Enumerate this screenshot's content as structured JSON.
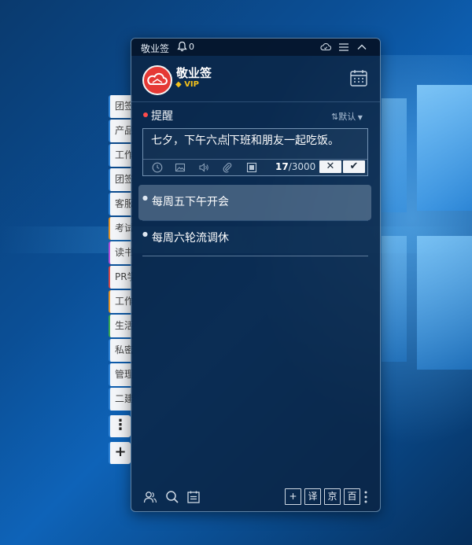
{
  "side_tabs": [
    "团签",
    "产品",
    "工作",
    "团签",
    "客服",
    "考试",
    "读书",
    "PR学",
    "工作",
    "生活",
    "私密",
    "管理",
    "二建"
  ],
  "side_buttons": {
    "more": "⋮",
    "add": "+"
  },
  "titlebar": {
    "app_name": "敬业签",
    "notification_count": "0"
  },
  "profile": {
    "name": "敬业签",
    "vip_badge": "VIP"
  },
  "section": {
    "title": "提醒",
    "sort_label": "默认"
  },
  "editor": {
    "text_before_caret": "七夕，下午六点",
    "text_after_caret": "下班和朋友一起吃饭。",
    "char_count": "17",
    "char_limit": "/3000"
  },
  "items": [
    {
      "text": "每周五下午开会",
      "selected": true
    },
    {
      "text": "每周六轮流调休",
      "selected": false
    }
  ],
  "footer": {
    "buttons": [
      "+",
      "译",
      "京",
      "百"
    ]
  },
  "colors": {
    "accent_red": "#e53935",
    "vip_gold": "#f4c21b",
    "window_bg": "#0a2444"
  }
}
